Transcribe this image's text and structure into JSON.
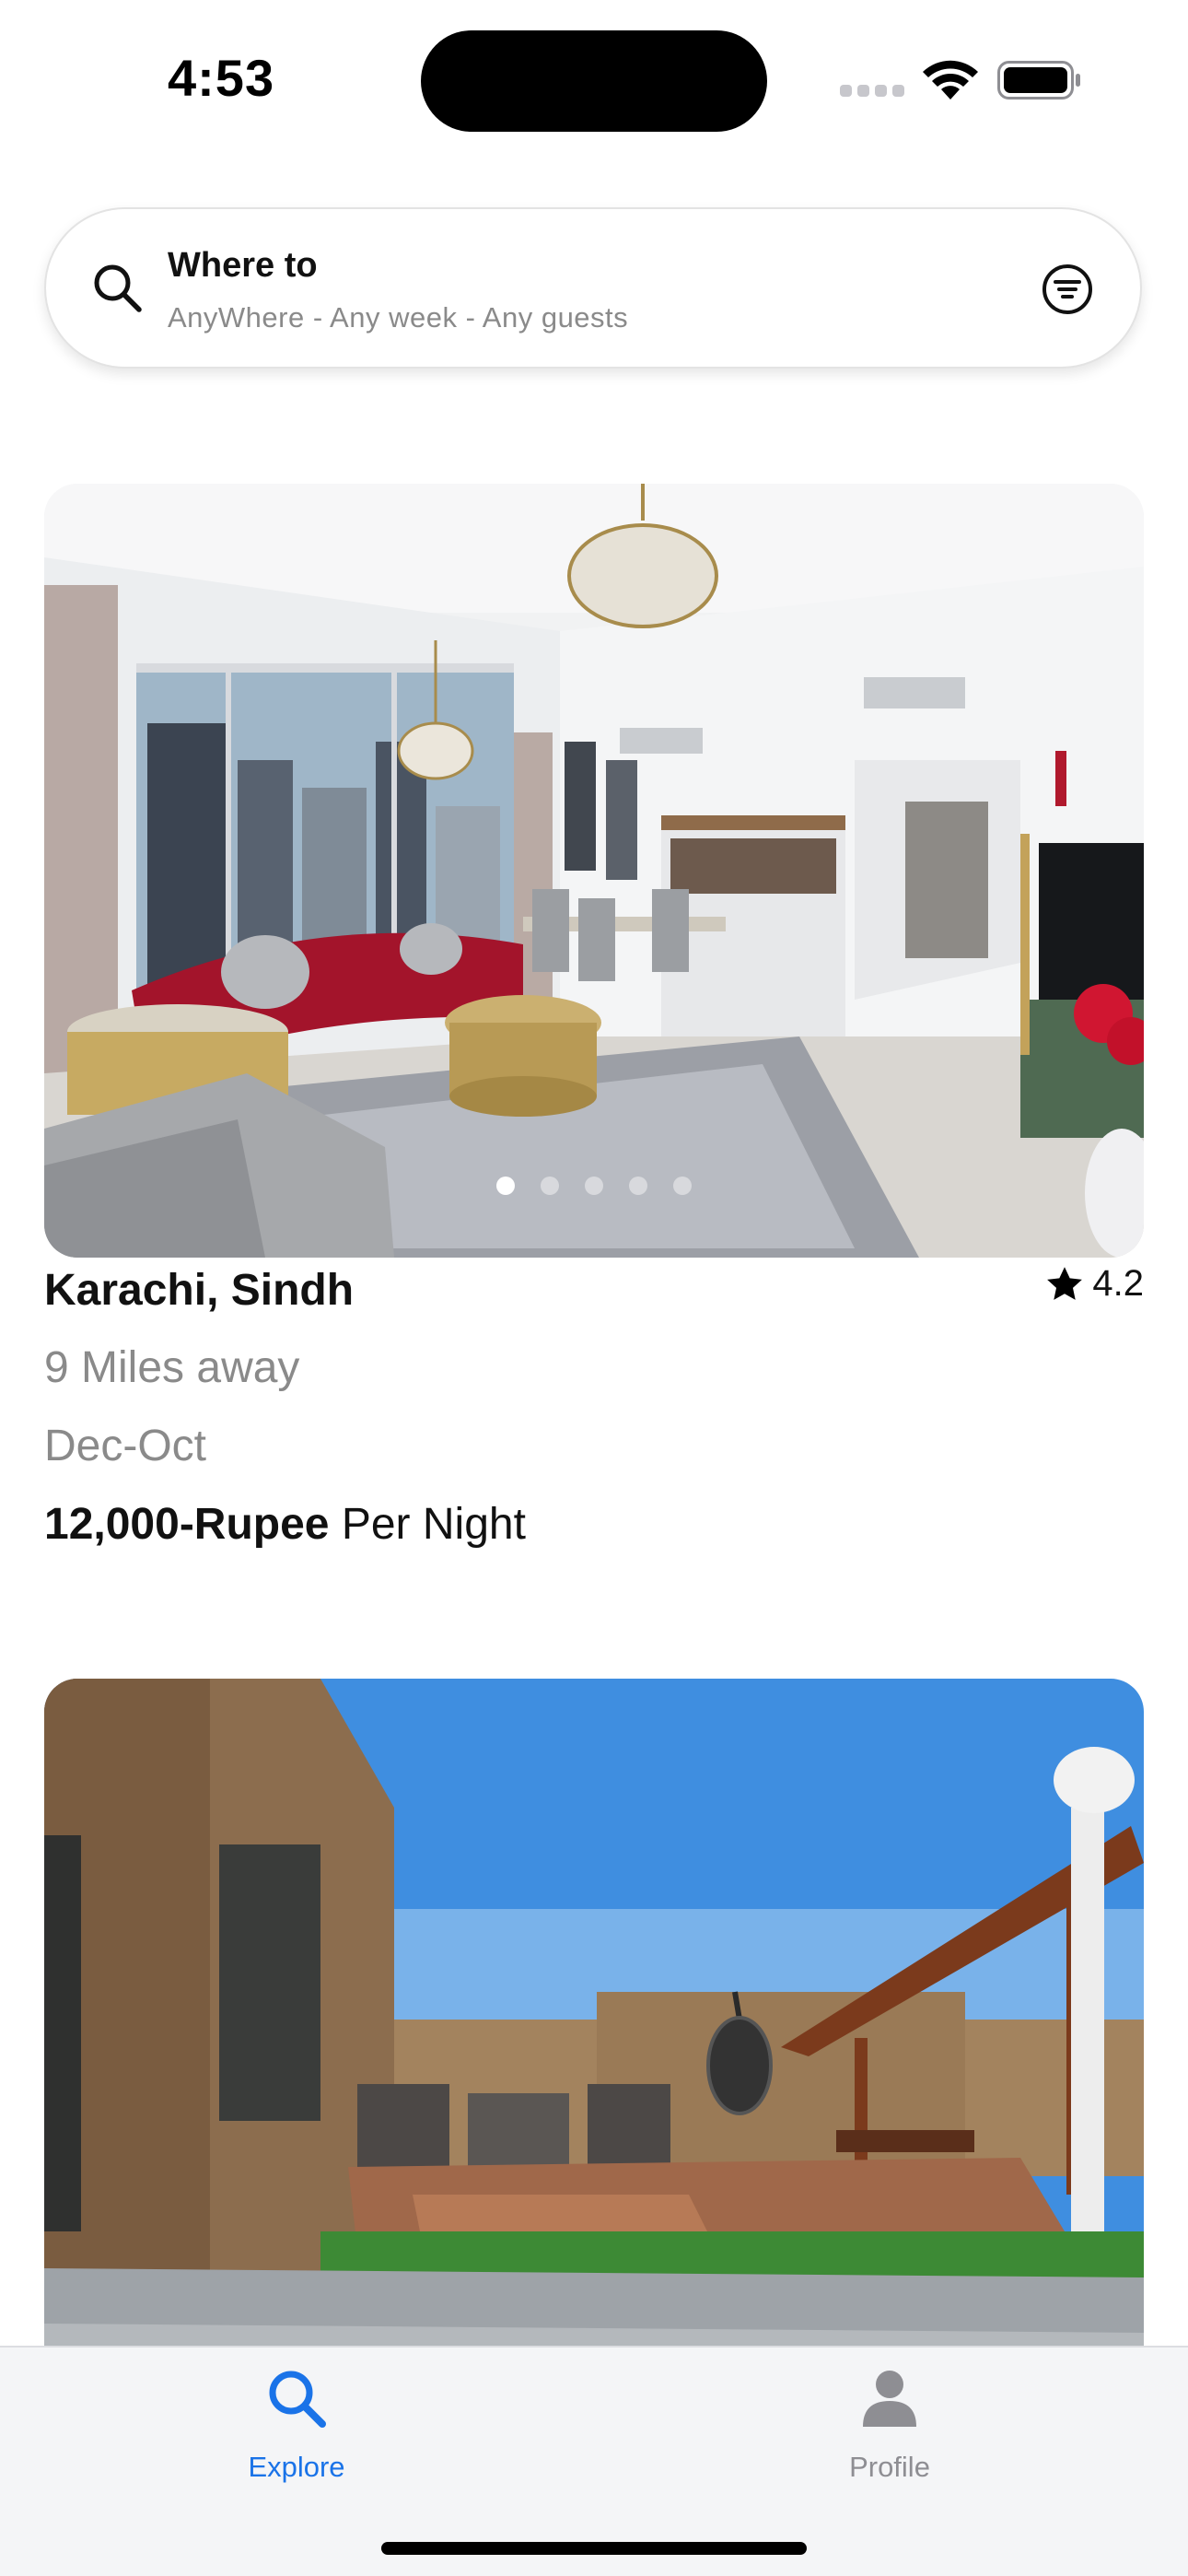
{
  "status_bar": {
    "time": "4:53"
  },
  "search": {
    "title": "Where to",
    "subtitle": "AnyWhere - Any week - Any guests",
    "icon": "search-icon",
    "filter_icon": "filter-icon"
  },
  "listings": [
    {
      "location": "Karachi, Sindh",
      "rating": "4.2",
      "distance": "9 Miles away",
      "dates": "Dec-Oct",
      "price_amount": "12,000-Rupee",
      "price_unit": " Per Night",
      "photo_subject": "living room interior",
      "photo_count": 5,
      "active_photo": 1
    },
    {
      "photo_subject": "rooftop terrace"
    }
  ],
  "tab_bar": {
    "tabs": [
      {
        "label": "Explore",
        "icon": "search-icon",
        "active": true
      },
      {
        "label": "Profile",
        "icon": "person-icon",
        "active": false
      }
    ]
  },
  "colors": {
    "accent": "#1a73e8",
    "muted_text": "#8a8a8a",
    "tab_inactive": "#8e8e93"
  }
}
